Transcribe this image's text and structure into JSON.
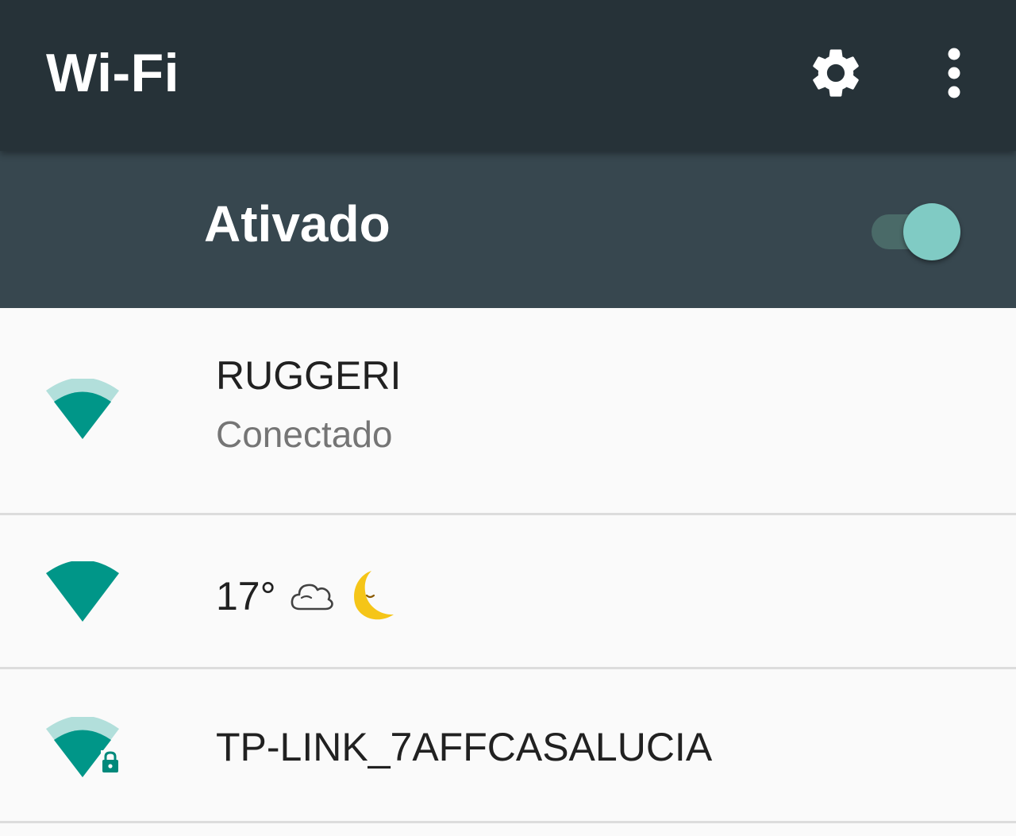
{
  "app_bar": {
    "title": "Wi-Fi",
    "settings_icon": "gear-icon",
    "overflow_icon": "more-vert-icon"
  },
  "master_switch": {
    "label": "Ativado",
    "state": "on"
  },
  "networks": [
    {
      "name": "RUGGERI",
      "status": "Conectado",
      "signal_icon": "wifi-signal-3-of-4-icon",
      "secured": false
    },
    {
      "name_parts": {
        "temperature": "17°",
        "weather_icon": "cloud-icon",
        "moon_icon": "sleeping-crescent-moon-icon"
      },
      "signal_icon": "wifi-signal-full-icon",
      "secured": false
    },
    {
      "name": "TP-LINK_7AFFCASALUCIA",
      "signal_icon": "wifi-signal-3-of-4-icon",
      "secured": true,
      "lock_icon": "lock-icon"
    }
  ],
  "colors": {
    "app_bar": "#263238",
    "master_bar": "#37474f",
    "accent": "#009688",
    "accent_light": "#b2dfdb",
    "toggle_thumb": "#80cbc4",
    "list_background": "#fafafa",
    "moon": "#f5c518"
  }
}
